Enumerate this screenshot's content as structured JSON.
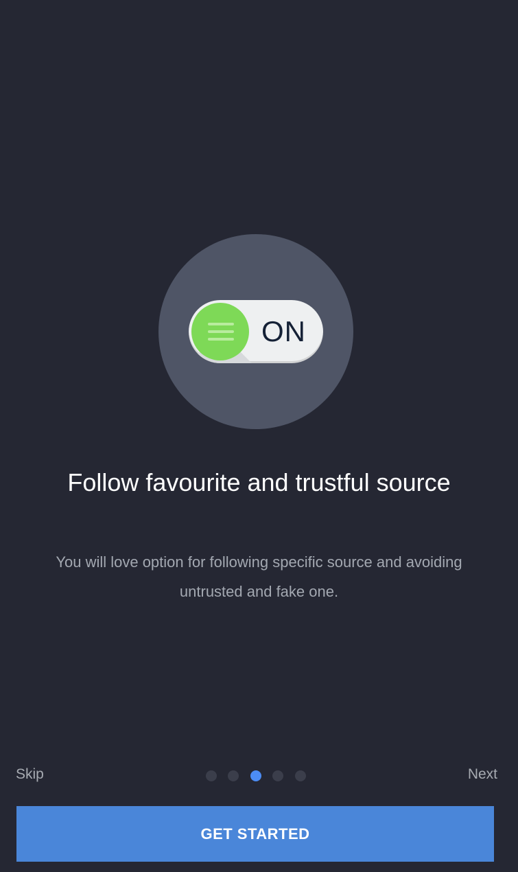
{
  "illustration": {
    "toggle_text": "ON",
    "colors": {
      "circle": "#4f5566",
      "knob": "#7ed957",
      "track": "#eef0f1"
    }
  },
  "content": {
    "title": "Follow favourite and trustful source",
    "description": "You will love option for following specific source and avoiding untrusted and fake one."
  },
  "navigation": {
    "skip_label": "Skip",
    "next_label": "Next",
    "page_count": 5,
    "active_page": 3
  },
  "cta": {
    "label": "GET STARTED",
    "color": "#4a86d9"
  }
}
